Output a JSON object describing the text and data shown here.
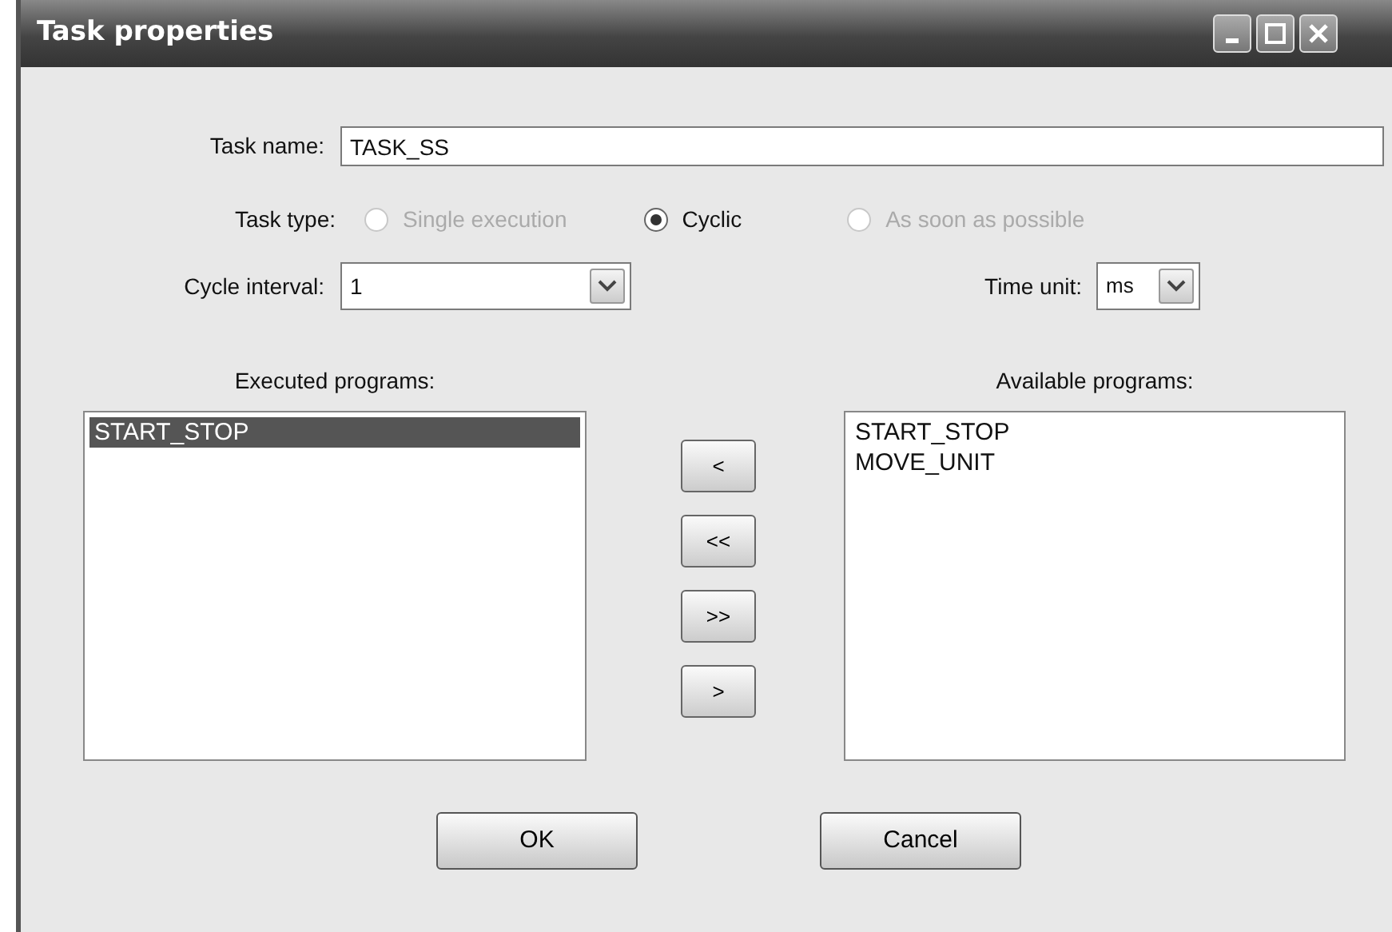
{
  "window": {
    "title": "Task properties"
  },
  "task_name": {
    "label": "Task name:",
    "value": "TASK_SS"
  },
  "task_type": {
    "label": "Task type:",
    "options": [
      {
        "label": "Single execution",
        "selected": false,
        "disabled": true
      },
      {
        "label": "Cyclic",
        "selected": true,
        "disabled": false
      },
      {
        "label": "As soon as possible",
        "selected": false,
        "disabled": true
      }
    ]
  },
  "cycle_interval": {
    "label": "Cycle interval:",
    "value": "1"
  },
  "time_unit": {
    "label": "Time unit:",
    "value": "ms"
  },
  "executed_programs": {
    "label": "Executed programs:",
    "items": [
      {
        "label": "START_STOP",
        "selected": true
      }
    ]
  },
  "transfer_buttons": [
    "<",
    "<<",
    ">>",
    ">"
  ],
  "available_programs": {
    "label": "Available programs:",
    "items": [
      {
        "label": "START_STOP",
        "selected": false
      },
      {
        "label": "MOVE_UNIT",
        "selected": false
      }
    ]
  },
  "buttons": [
    "OK",
    "Cancel"
  ]
}
